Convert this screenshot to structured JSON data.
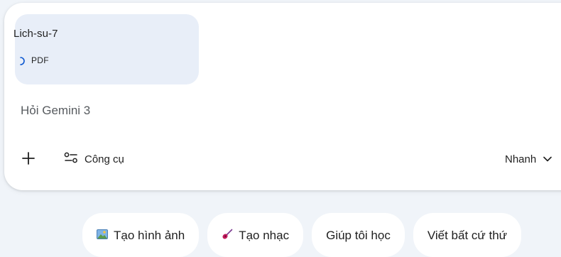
{
  "attachment": {
    "name": "Lich-su-7",
    "type": "PDF",
    "status_icon": "loading-spinner-icon"
  },
  "prompt": {
    "placeholder": "Hỏi Gemini 3",
    "value": ""
  },
  "toolbar": {
    "add_icon": "plus-icon",
    "tools_icon": "tune-icon",
    "tools_label": "Công cụ",
    "mode_label": "Nhanh",
    "mode_icon": "chevron-down-icon"
  },
  "suggestions": [
    {
      "label": "Tạo hình ảnh",
      "icon": "image-emoji-icon"
    },
    {
      "label": "Tạo nhạc",
      "icon": "guitar-emoji-icon"
    },
    {
      "label": "Giúp tôi học",
      "icon": ""
    },
    {
      "label": "Viết bất cứ thứ",
      "icon": ""
    }
  ],
  "colors": {
    "page_background": "#f0f4f9",
    "composer_background": "#ffffff",
    "attachment_chip_background": "#e8eef8",
    "spinner_accent": "#0b57d0"
  }
}
